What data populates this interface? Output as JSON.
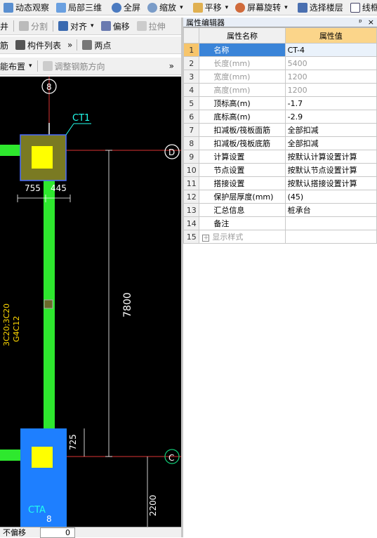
{
  "toolbar1": {
    "items": [
      "动态观察",
      "局部三维",
      "全屏",
      "缩放",
      "平移",
      "屏幕旋转",
      "选择楼层",
      "线框"
    ]
  },
  "toolbar2": {
    "items": [
      "井",
      "分割",
      "对齐",
      "偏移",
      "拉伸"
    ]
  },
  "toolbar3": {
    "items": [
      "筋",
      "构件列表",
      "两点"
    ]
  },
  "toolbar4": {
    "items": [
      "能布置",
      "调整钢筋方向"
    ]
  },
  "panel": {
    "title": "属性编辑器",
    "pin": "ᵖ",
    "close": "×",
    "col_name": "属性名称",
    "col_value": "属性值",
    "rows": [
      {
        "n": "1",
        "name": "名称",
        "value": "CT-4"
      },
      {
        "n": "2",
        "name": "长度(mm)",
        "value": "5400"
      },
      {
        "n": "3",
        "name": "宽度(mm)",
        "value": "1200"
      },
      {
        "n": "4",
        "name": "高度(mm)",
        "value": "1200"
      },
      {
        "n": "5",
        "name": "顶标高(m)",
        "value": "-1.7"
      },
      {
        "n": "6",
        "name": "底标高(m)",
        "value": "-2.9"
      },
      {
        "n": "7",
        "name": "扣减板/筏板面筋",
        "value": "全部扣减"
      },
      {
        "n": "8",
        "name": "扣减板/筏板底筋",
        "value": "全部扣减"
      },
      {
        "n": "9",
        "name": "计算设置",
        "value": "按默认计算设置计算"
      },
      {
        "n": "10",
        "name": "节点设置",
        "value": "按默认节点设置计算"
      },
      {
        "n": "11",
        "name": "搭接设置",
        "value": "按默认搭接设置计算"
      },
      {
        "n": "12",
        "name": "保护层厚度(mm)",
        "value": "(45)"
      },
      {
        "n": "13",
        "name": "汇总信息",
        "value": "桩承台"
      },
      {
        "n": "14",
        "name": "备注",
        "value": ""
      },
      {
        "n": "15",
        "name": "显示样式",
        "value": ""
      }
    ]
  },
  "cad": {
    "label_ct1": "CT1",
    "label_cta": "CTA",
    "axis_8": "8",
    "axis_d": "D",
    "axis_c": "C",
    "dim_755": "755",
    "dim_445": "445",
    "dim_7800": "7800",
    "dim_725": "725",
    "dim_2200": "2200",
    "rebar_a": "3C20;3C20",
    "rebar_b": "G4C12"
  },
  "statusbar": {
    "label": "不偏移",
    "value": "0"
  }
}
